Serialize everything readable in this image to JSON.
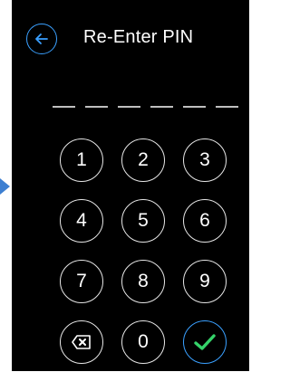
{
  "header": {
    "title": "Re-Enter PIN",
    "back_icon": "arrow-left-icon"
  },
  "pin": {
    "length": 6,
    "entered": 0
  },
  "keypad": {
    "keys": [
      "1",
      "2",
      "3",
      "4",
      "5",
      "6",
      "7",
      "8",
      "9"
    ],
    "zero": "0",
    "backspace_icon": "backspace-icon",
    "confirm_icon": "checkmark-icon"
  },
  "colors": {
    "background": "#000000",
    "accent_blue": "#3aa0ff",
    "confirm_green": "#35d36a",
    "pointer_arrow": "#3d7fd1"
  }
}
